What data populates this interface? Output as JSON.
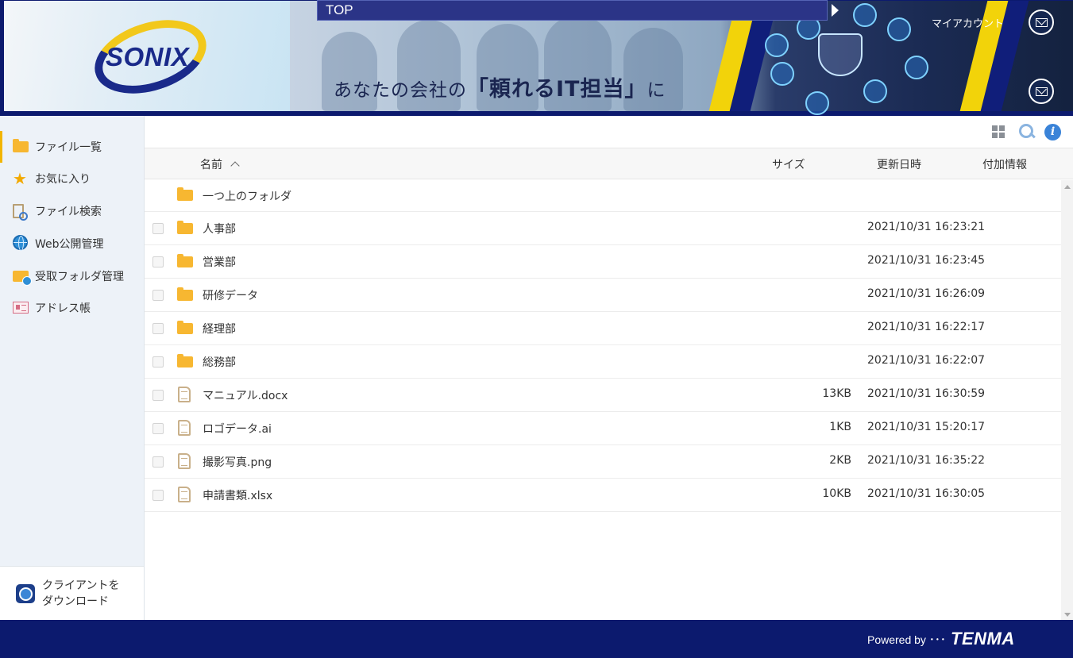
{
  "header": {
    "logo_text": "SONIX",
    "tagline_pre": "あなたの会社の",
    "tagline_big": "「頼れるIT担当」",
    "tagline_post": "に",
    "top_label": "TOP",
    "account_label": "マイアカウント"
  },
  "sidebar": {
    "items": [
      {
        "label": "ファイル一覧",
        "icon": "folder-icon"
      },
      {
        "label": "お気に入り",
        "icon": "star-icon"
      },
      {
        "label": "ファイル検索",
        "icon": "document-search-icon"
      },
      {
        "label": "Web公開管理",
        "icon": "globe-icon"
      },
      {
        "label": "受取フォルダ管理",
        "icon": "receive-folder-icon"
      },
      {
        "label": "アドレス帳",
        "icon": "address-card-icon"
      }
    ],
    "client_download": "クライアントを\nダウンロード"
  },
  "table": {
    "headers": {
      "name": "名前",
      "size": "サイズ",
      "updated": "更新日時",
      "extra": "付加情報"
    },
    "parent_folder": "一つ上のフォルダ",
    "rows": [
      {
        "name": "人事部",
        "type": "folder",
        "size": "",
        "updated": "2021/10/31 16:23:21"
      },
      {
        "name": "営業部",
        "type": "folder",
        "size": "",
        "updated": "2021/10/31 16:23:45"
      },
      {
        "name": "研修データ",
        "type": "folder",
        "size": "",
        "updated": "2021/10/31 16:26:09"
      },
      {
        "name": "経理部",
        "type": "folder",
        "size": "",
        "updated": "2021/10/31 16:22:17"
      },
      {
        "name": "総務部",
        "type": "folder",
        "size": "",
        "updated": "2021/10/31 16:22:07"
      },
      {
        "name": "マニュアル.docx",
        "type": "file",
        "size": "13KB",
        "updated": "2021/10/31 16:30:59"
      },
      {
        "name": "ロゴデータ.ai",
        "type": "file",
        "size": "1KB",
        "updated": "2021/10/31 15:20:17"
      },
      {
        "name": "撮影写真.png",
        "type": "file",
        "size": "2KB",
        "updated": "2021/10/31 16:35:22"
      },
      {
        "name": "申請書類.xlsx",
        "type": "file",
        "size": "10KB",
        "updated": "2021/10/31 16:30:05"
      }
    ]
  },
  "footer": {
    "powered_by": "Powered by ･･･",
    "brand": "TENMA"
  },
  "colors": {
    "navy": "#0c1a6e",
    "accent_yellow": "#f2d30a",
    "folder": "#f7b731",
    "info_blue": "#3a83d8"
  }
}
